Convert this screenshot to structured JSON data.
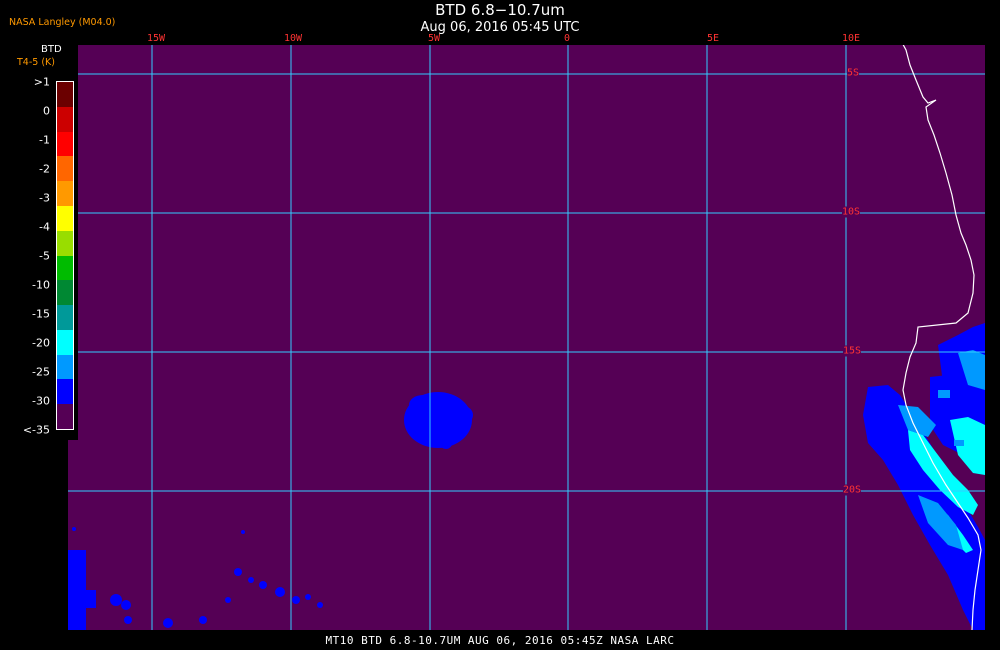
{
  "header": {
    "title": "BTD 6.8−10.7um",
    "date": "Aug 06, 2016 05:45 UTC",
    "credit": "NASA Langley (M04.0)"
  },
  "footer": {
    "text": "MT10   BTD 6.8-10.7UM    AUG 06, 2016 05:45Z   NASA LARC"
  },
  "legend": {
    "label": "BTD",
    "units": "T4-5 (K)",
    "ticks": [
      ">1",
      "0",
      "-1",
      "-2",
      "-3",
      "-4",
      "-5",
      "-10",
      "-15",
      "-20",
      "-25",
      "-30",
      "<-35"
    ],
    "colors": [
      "#6b0000",
      "#cc0000",
      "#ff0000",
      "#ff6600",
      "#ff9900",
      "#ffff00",
      "#99dd00",
      "#00bb00",
      "#008833",
      "#009999",
      "#00ffff",
      "#0099ff",
      "#0000ff",
      "#550055"
    ]
  },
  "map": {
    "background_color": "#550055",
    "grid_color": "#33ccff",
    "coast_color": "#ffffff",
    "lon_labels": [
      "15W",
      "10W",
      "5W",
      "0",
      "5E",
      "10E"
    ],
    "lat_labels": [
      "5S",
      "10S",
      "15S",
      "20S"
    ]
  }
}
